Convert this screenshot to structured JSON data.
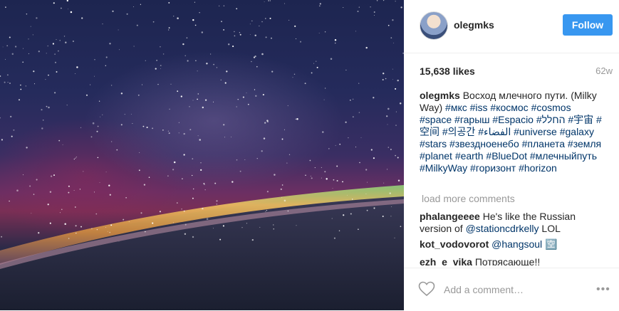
{
  "header": {
    "username": "olegmks",
    "follow_label": "Follow"
  },
  "post": {
    "likes": "15,638 likes",
    "time": "62w",
    "caption_user": "olegmks",
    "caption_text": "Восход млечного пути. (Milky Way)",
    "hashtags": "#мкс #iss #космос #cosmos #space #гарыш #Espacio #החלל #宇宙 #空间 #의공간 #الفضاء #universe #galaxy #stars #звездноенебо #планета #земля #planet #earth #BlueDot #млечныйпуть #MilkyWay #горизонт #horizon"
  },
  "comments": {
    "load_more": "load more comments",
    "items": [
      {
        "user": "phalangeeee",
        "text_before": "He's like the Russian version of ",
        "mention": "@stationcdrkelly",
        "text_after": " LOL"
      },
      {
        "user": "kot_vodovorot",
        "mention": "@hangsoul",
        "text_after": " 🈳"
      },
      {
        "user": "ezh_e_vika",
        "text_after": "Потрясающе!!"
      }
    ]
  },
  "add_comment": {
    "placeholder": "Add a comment…",
    "more_label": "•••"
  },
  "icons": {
    "heart": "heart-outline-icon",
    "avatar": "avatar"
  },
  "colors": {
    "follow_button": "#3897f0",
    "link": "#003569",
    "muted": "#999999"
  }
}
